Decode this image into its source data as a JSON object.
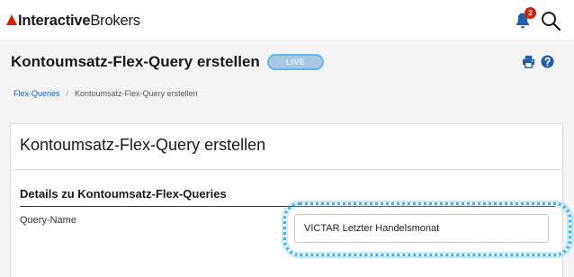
{
  "brand": {
    "bold": "Interactive",
    "light": "Brokers",
    "accent": "#d81e05"
  },
  "notifications": {
    "count": "2"
  },
  "header": {
    "title": "Kontoumsatz-Flex-Query erstellen",
    "pill": "LIVE"
  },
  "breadcrumb": {
    "link": "Flex-Queries",
    "separator": "/",
    "current": "Kontoumsatz-Flex-Query erstellen"
  },
  "card": {
    "title": "Kontoumsatz-Flex-Query erstellen",
    "section_title": "Details zu Kontoumsatz-Flex-Queries",
    "fields": {
      "query_name": {
        "label": "Query-Name",
        "value": "VICTAR Letzter Handelsmonat"
      }
    }
  },
  "colors": {
    "link": "#1d5fa8",
    "highlight": "#3ab4ea",
    "page_bg": "#f4f4f4"
  },
  "icons": [
    "bell-icon",
    "search-icon",
    "print-icon",
    "help-icon"
  ]
}
